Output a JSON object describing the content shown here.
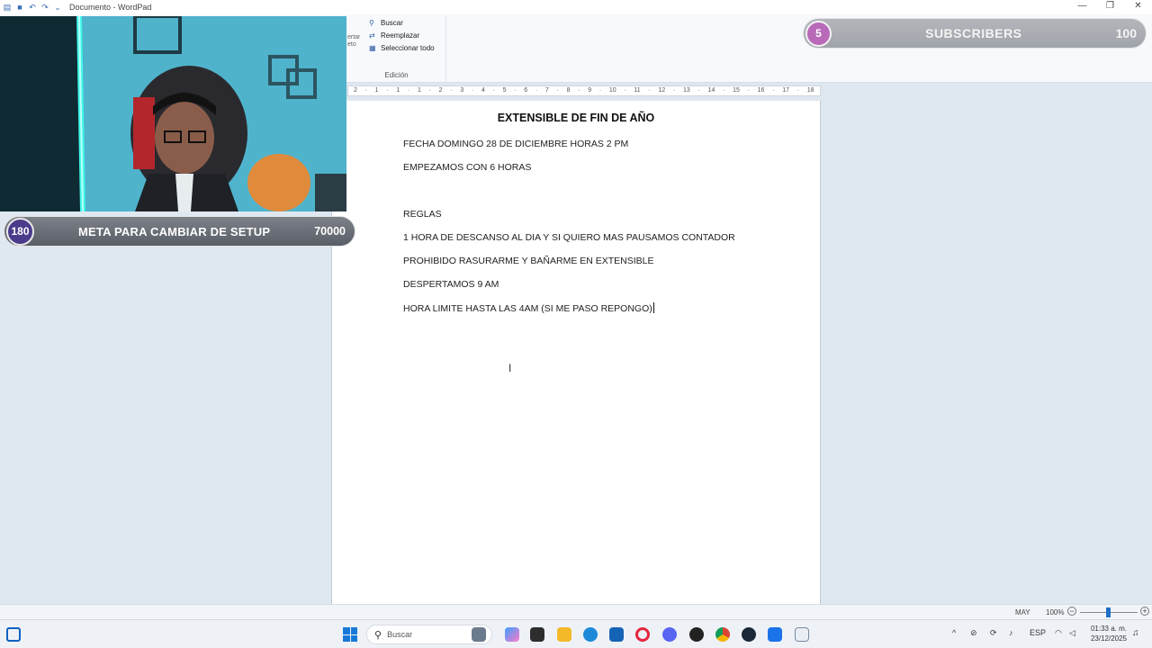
{
  "window": {
    "title": "Documento - WordPad",
    "controls": [
      "—",
      "❐",
      "✕"
    ]
  },
  "ribbon": {
    "edit_group": {
      "find": "Buscar",
      "replace": "Reemplazar",
      "select_all": "Seleccionar todo",
      "caption": "Edición"
    },
    "paste_fragment": [
      "ertar",
      "eto"
    ]
  },
  "ruler": {
    "marks": [
      "2",
      "·",
      "1",
      "·",
      "1",
      "·",
      "1",
      "·",
      "2",
      "·",
      "3",
      "·",
      "4",
      "·",
      "5",
      "·",
      "6",
      "·",
      "7",
      "·",
      "8",
      "·",
      "9",
      "·",
      "10",
      "·",
      "11",
      "·",
      "12",
      "·",
      "13",
      "·",
      "14",
      "·",
      "15",
      "·",
      "16",
      "·",
      "17",
      "·",
      "18"
    ]
  },
  "document": {
    "title": "EXTENSIBLE DE FIN DE AÑO",
    "lines": [
      "FECHA DOMINGO 28 DE DICIEMBRE HORAS 2 PM",
      "EMPEZAMOS CON 6 HORAS",
      "",
      "REGLAS",
      "1 HORA DE DESCANSO AL DIA Y SI QUIERO MAS PAUSAMOS CONTADOR",
      "PROHIBIDO RASURARME Y BAÑARME EN EXTENSIBLE",
      "DESPERTAMOS 9 AM",
      "HORA LIMITE HASTA LAS 4AM (SI ME PASO REPONGO)"
    ]
  },
  "overlays": {
    "setup_goal": {
      "current": "180",
      "label": "META PARA CAMBIAR DE SETUP",
      "target": "70000"
    },
    "subscribers_goal": {
      "current": "5",
      "label": "SUBSCRIBERS",
      "target": "100"
    }
  },
  "statusbar": {
    "caps": "MAY",
    "zoom": "100%",
    "zoom_minus": "−",
    "zoom_plus": "+",
    "zoom_level": 0.5
  },
  "taskbar": {
    "search_placeholder": "Buscar",
    "tray": {
      "chevron": "^",
      "language": "ESP",
      "time": "01:33 a. m.",
      "date": "23/12/2025"
    }
  },
  "colors": {
    "page_bg": "#dfe8f0",
    "setup_badge": "#4c3a8a",
    "subs_badge": "#b86ab8",
    "accent": "#1878d8"
  }
}
